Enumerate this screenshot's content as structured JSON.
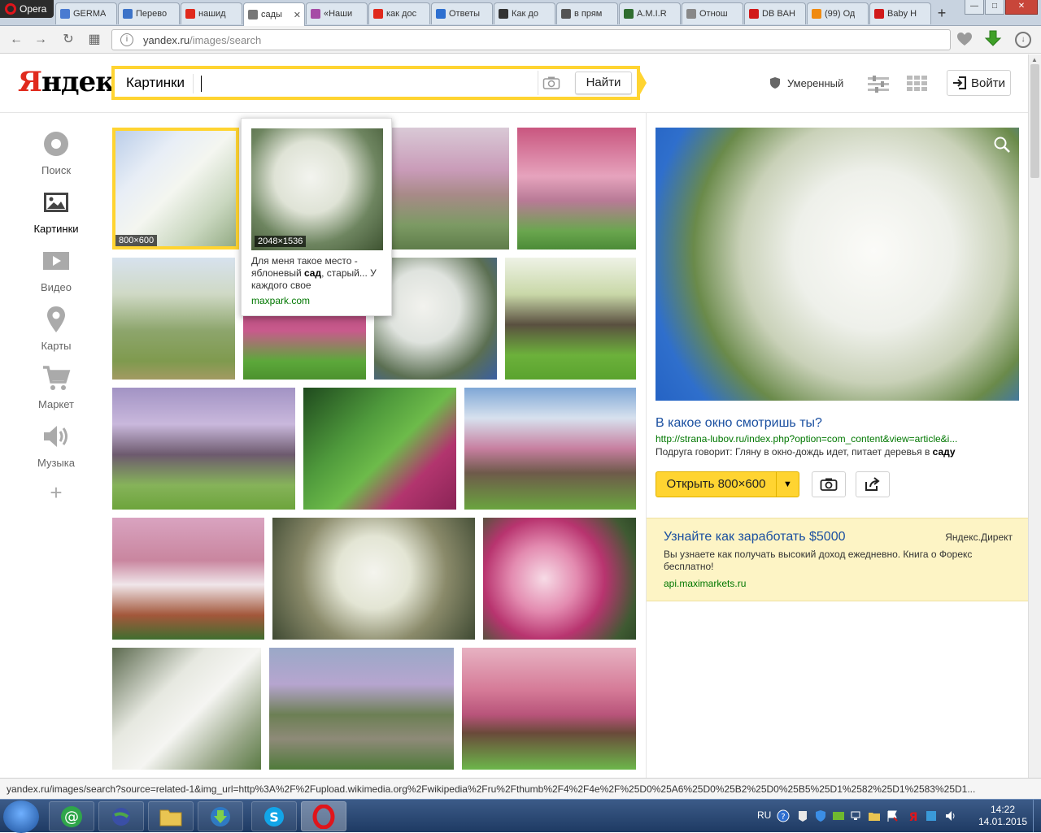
{
  "browser": {
    "menu_label": "Opera",
    "tabs": [
      {
        "label": "GERMA",
        "color": "#4a7bd1"
      },
      {
        "label": "Перево",
        "color": "#3c73c8"
      },
      {
        "label": "нашид",
        "color": "#e02a1d"
      },
      {
        "label": "сады",
        "color": "#777777",
        "active": true
      },
      {
        "label": "«Наши",
        "color": "#a64ca6"
      },
      {
        "label": "как дос",
        "color": "#e02a1d"
      },
      {
        "label": "Ответы",
        "color": "#2d6fd0"
      },
      {
        "label": "Как до",
        "color": "#333333"
      },
      {
        "label": "в прям",
        "color": "#555555"
      },
      {
        "label": "A.M.I.R",
        "color": "#2f6d2f"
      },
      {
        "label": "Отнош",
        "color": "#888888"
      },
      {
        "label": "DB BAH",
        "color": "#d11a1a"
      },
      {
        "label": "(99) Од",
        "color": "#f08a10"
      },
      {
        "label": "Baby H",
        "color": "#d11a1a"
      }
    ],
    "tab_close": "✕",
    "new_tab": "+",
    "window_controls": [
      "—",
      "□",
      "✕"
    ],
    "url_host": "yandex.ru",
    "url_path": "/images/search",
    "back": "←",
    "forward": "→",
    "reload": "↻",
    "speed_dial": "▦"
  },
  "header": {
    "logo_first": "Я",
    "logo_rest": "ндекс",
    "service": "Картинки",
    "query": "",
    "find_label": "Найти",
    "filter_label": "Умеренный",
    "login_label": "Войти"
  },
  "sidebar": {
    "items": [
      {
        "label": "Поиск",
        "icon": "search-icon"
      },
      {
        "label": "Картинки",
        "icon": "images-icon",
        "active": true
      },
      {
        "label": "Видео",
        "icon": "video-icon"
      },
      {
        "label": "Карты",
        "icon": "map-pin-icon"
      },
      {
        "label": "Маркет",
        "icon": "cart-icon"
      },
      {
        "label": "Музыка",
        "icon": "speaker-icon"
      }
    ],
    "more": "+"
  },
  "grid": {
    "selected_res": "800×600"
  },
  "popup": {
    "resolution": "2048×1536",
    "text_before": "Для меня такое место - яблоневый ",
    "text_bold": "сад",
    "text_after": ", старый... У каждого свое",
    "domain": "maxpark.com"
  },
  "preview": {
    "title": "В какое окно смотришь ты?",
    "url": "http://strana-lubov.ru/index.php?option=com_content&view=article&i...",
    "desc_before": "Подруга говорит: Гляну в окно-дождь идет, питает деревья в ",
    "desc_bold": "саду",
    "open_label": "Открыть 800×600"
  },
  "ad": {
    "title": "Узнайте как заработать $5000",
    "brand": "Яндекс.Директ",
    "text": "Вы узнаете как получать высокий доход ежедневно. Книга о Форекс бесплатно!",
    "url": "api.maximarkets.ru"
  },
  "status": {
    "text": "yandex.ru/images/search?source=related-1&img_url=http%3A%2F%2Fupload.wikimedia.org%2Fwikipedia%2Fru%2Fthumb%2F4%2F4e%2F%25D0%25A6%25D0%25B2%25D0%25B5%25D1%2582%25D1%2583%25D1..."
  },
  "taskbar": {
    "lang": "RU",
    "time": "14:22",
    "date": "14.01.2015"
  }
}
